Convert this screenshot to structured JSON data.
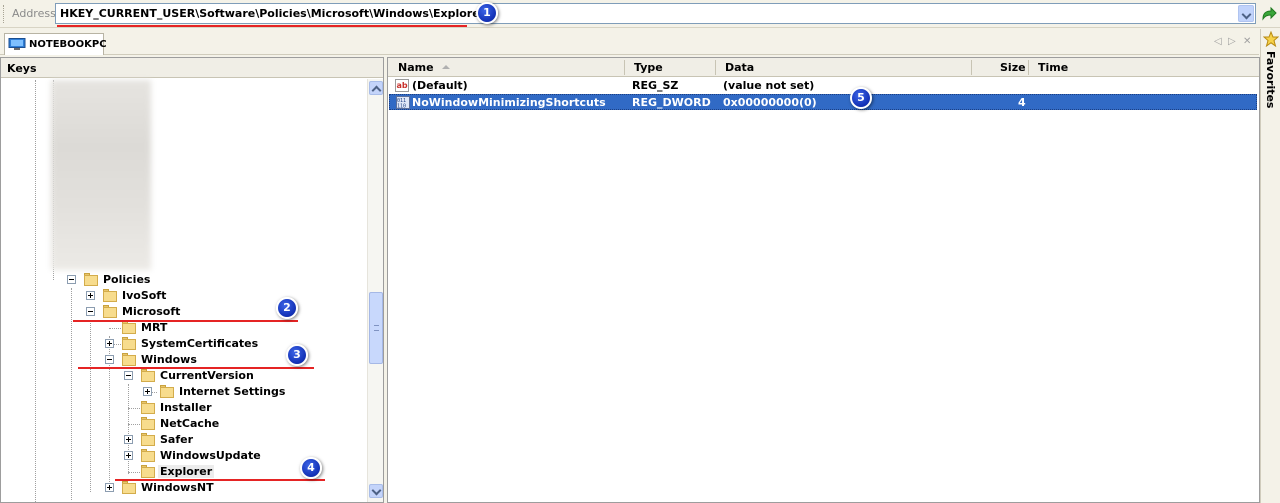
{
  "address": {
    "label": "Address",
    "value": "HKEY_CURRENT_USER\\Software\\Policies\\Microsoft\\Windows\\Explorer"
  },
  "tab": {
    "computer": "NOTEBOOKPC"
  },
  "favorites": {
    "label": "Favorites"
  },
  "keys": {
    "title": "Keys",
    "nodes": [
      {
        "label": "Policies"
      },
      {
        "label": "IvoSoft"
      },
      {
        "label": "Microsoft"
      },
      {
        "label": "MRT"
      },
      {
        "label": "SystemCertificates"
      },
      {
        "label": "Windows"
      },
      {
        "label": "CurrentVersion"
      },
      {
        "label": "Internet Settings"
      },
      {
        "label": "Installer"
      },
      {
        "label": "NetCache"
      },
      {
        "label": "Safer"
      },
      {
        "label": "WindowsUpdate"
      },
      {
        "label": "Explorer"
      },
      {
        "label": "WindowsNT"
      }
    ]
  },
  "values": {
    "columns": {
      "name": "Name",
      "type": "Type",
      "data": "Data",
      "size": "Size",
      "time": "Time"
    },
    "rows": [
      {
        "name": "(Default)",
        "type": "REG_SZ",
        "data": "(value not set)",
        "size": "",
        "time": ""
      },
      {
        "name": "NoWindowMinimizingShortcuts",
        "type": "REG_DWORD",
        "data": "0x00000000(0)",
        "size": "4",
        "time": ""
      }
    ]
  },
  "annotations": {
    "b1": "1",
    "b2": "2",
    "b3": "3",
    "b4": "4",
    "b5": "5"
  },
  "colors": {
    "selection": "#316ac5",
    "annotation_line": "#e52424",
    "badge": "#1433b8"
  }
}
